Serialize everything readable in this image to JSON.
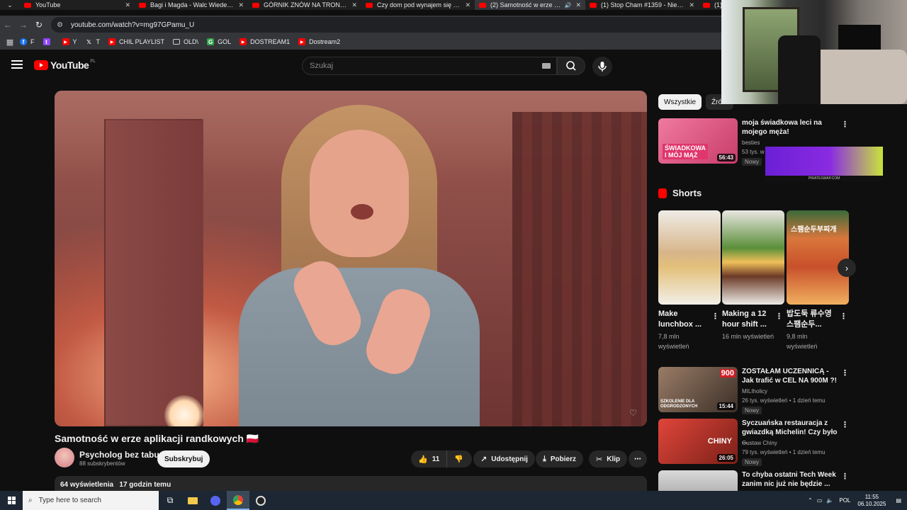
{
  "browser": {
    "tabs": [
      {
        "label": "YouTube",
        "active": false
      },
      {
        "label": "Bagi i Magda - Walc Wiedeński",
        "active": false
      },
      {
        "label": "GÓRNIK ZNÓW NA TRONIE! Sl",
        "active": false
      },
      {
        "label": "Czy dom pod wynajem się opła",
        "active": false
      },
      {
        "label": "(2) Samotność w erze aplika",
        "active": true
      },
      {
        "label": "(1) Stop Cham #1359 - Niebez",
        "active": false
      },
      {
        "label": "(1) M",
        "active": false
      }
    ],
    "url": "youtube.com/watch?v=mg97GPamu_U",
    "bookmarks": [
      {
        "label": "F",
        "color": "#1877f2",
        "glyph": "f"
      },
      {
        "label": "",
        "color": "#9146ff",
        "glyph": "t"
      },
      {
        "label": "Y",
        "color": "#ff0000",
        "glyph": "▶"
      },
      {
        "label": "T",
        "color": "#000000",
        "glyph": "X"
      },
      {
        "label": "CHIL PLAYLIST",
        "color": "#ff0000",
        "glyph": "▶"
      },
      {
        "label": "OLD\\",
        "color": "",
        "glyph": "folder"
      },
      {
        "label": "GOL",
        "color": "#2fa34a",
        "glyph": "G"
      },
      {
        "label": "DOSTREAM1",
        "color": "#ff0000",
        "glyph": "▶"
      },
      {
        "label": "Dostream2",
        "color": "#ff0000",
        "glyph": "▶"
      }
    ]
  },
  "youtube": {
    "logo_text": "YouTube",
    "logo_country": "PL",
    "search_placeholder": "Szukaj"
  },
  "video": {
    "title": "Samotność w erze aplikacji randkowych 🇵🇱",
    "channel_name": "Psycholog bez tabu",
    "channel_subs": "88 subskrybentów",
    "subscribe_label": "Subskrybuj",
    "likes": "11",
    "share_label": "Udostępnij",
    "download_label": "Pobierz",
    "clip_label": "Klip",
    "views": "64 wyświetlenia",
    "uploaded": "17 godzin temu"
  },
  "sidebar": {
    "chips": [
      "Wszystkie",
      "Źródł"
    ],
    "recs_top": [
      {
        "title": "moja świadkowa leci na mojego męża!",
        "channel": "besties",
        "meta": "53 tys. w",
        "badge": "Nowy",
        "duration": "56:43",
        "thumb_text": "ŚWIADKOWA I MÓJ MĄŻ",
        "thumb_color": "#d8537c"
      }
    ],
    "shorts_label": "Shorts",
    "shorts": [
      {
        "title": "Make lunchbox ...",
        "views": "7,8 mln wyświetleń",
        "thumb_color": "#e7e3dc"
      },
      {
        "title": "Making a 12 hour shift ...",
        "views": "16 mln wyświetleń",
        "thumb_color": "#d9d6cf"
      },
      {
        "title": "밥도둑 류수영 스팸순두...",
        "views": "9,8 mln wyświetleń",
        "thumb_color": "#d9763c",
        "thumb_text": "스팸순두부찌개"
      }
    ],
    "recs": [
      {
        "title": "ZOSTAŁAM UCZENNICĄ - Jak trafić w CEL NA 900M ?!",
        "channel": "MILIholicy",
        "meta": "26 tys. wyświetleń • 1 dzień temu",
        "badge": "Nowy",
        "duration": "15:44",
        "thumb_text": "SZKOLENIE DLA ODGRODZONYCH",
        "badge_num": "900",
        "thumb_color": "#7a5b48"
      },
      {
        "title": "Syczuańska restauracja z gwiazdką Michelin! Czy było ...",
        "channel": "Gustaw Chiny",
        "meta": "79 tys. wyświetleń • 1 dzień temu",
        "badge": "Nowy",
        "duration": "26:05",
        "thumb_text": "CHINY",
        "thumb_color": "#b83a30"
      },
      {
        "title": "To chyba ostatni Tech Week zanim nic już nie będzie ...",
        "channel": "",
        "meta": "",
        "badge": "",
        "duration": "",
        "thumb_color": "#cfcfcf"
      }
    ],
    "promo_strip": "PIRATESWAP.COM"
  },
  "taskbar": {
    "search_placeholder": "Type here to search",
    "lang": "POL",
    "time": "11:55",
    "date": "06.10.2025"
  }
}
